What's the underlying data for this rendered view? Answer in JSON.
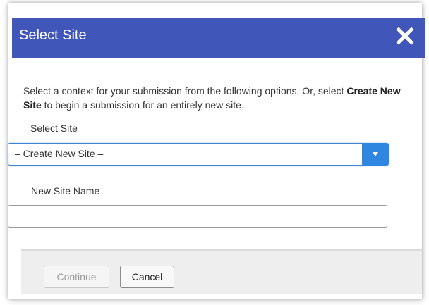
{
  "dialog": {
    "title": "Select Site",
    "close_icon": "close-x-icon",
    "header_color": "#4156b9"
  },
  "intro": {
    "text_before": "Select a context for your submission from the following options. Or, select ",
    "bold_text": "Create New Site",
    "text_after": " to begin a submission for an entirely new site."
  },
  "select_site": {
    "label": "Select Site",
    "value": "– Create New Site –",
    "arrow_icon": "caret-down-icon",
    "accent": "#2f86e0"
  },
  "new_site": {
    "label": "New Site Name",
    "value": "",
    "placeholder": ""
  },
  "footer": {
    "continue_label": "Continue",
    "cancel_label": "Cancel"
  }
}
